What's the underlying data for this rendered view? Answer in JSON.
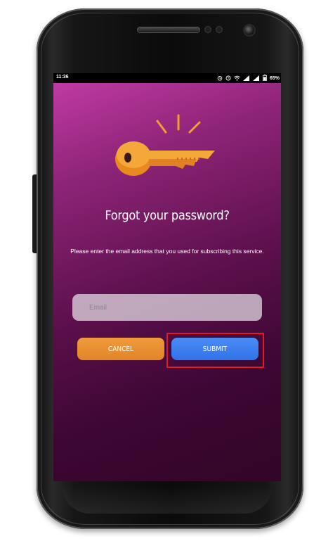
{
  "status_bar": {
    "time": "11:36",
    "icons": [
      "alarm-icon",
      "clock-icon",
      "wifi-icon",
      "signal-icon",
      "signal-icon",
      "battery-icon"
    ],
    "battery": "65%"
  },
  "screen": {
    "title": "Forgot your password?",
    "description": "Please enter the email address that you used for subscribing this service.",
    "email_placeholder": "Email",
    "cancel_label": "CANCEL",
    "submit_label": "SUBMIT"
  },
  "colors": {
    "gradient_top": "#c03aa3",
    "gradient_bottom": "#330527",
    "cancel_button": "#e8902f",
    "submit_button": "#3a7ef0",
    "highlight": "#e01a22",
    "key": "#f0a030"
  }
}
